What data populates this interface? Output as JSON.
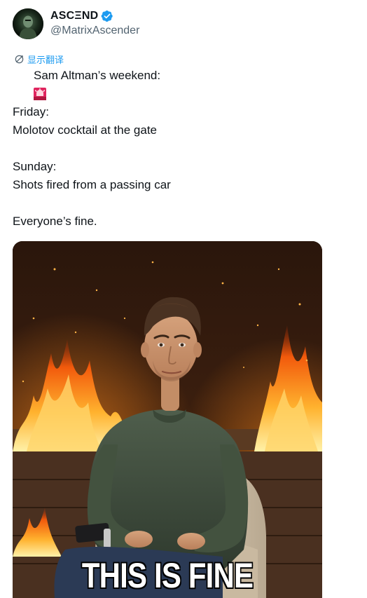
{
  "post": {
    "author": {
      "display_name": "ASCΞND",
      "handle": "@MatrixAscender",
      "verified": true,
      "avatar": "avatar-icon"
    },
    "translate_label": "显示翻译",
    "lines": [
      "Sam Altman’s weekend:",
      "",
      "Friday:",
      "Molotov cocktail at the gate",
      "",
      "Sunday:",
      "Shots fired from a passing car",
      "",
      "Everyone’s fine."
    ],
    "media": {
      "caption": "THIS IS FINE"
    }
  },
  "colors": {
    "text": "#0f1419",
    "secondary": "#536471",
    "link": "#1d9bf0",
    "verified": "#1d9bf0",
    "siren": "#e0245e"
  },
  "icons": {
    "verified": "verified-badge-icon",
    "translate": "translate-icon",
    "siren": "rotating-light-icon"
  }
}
